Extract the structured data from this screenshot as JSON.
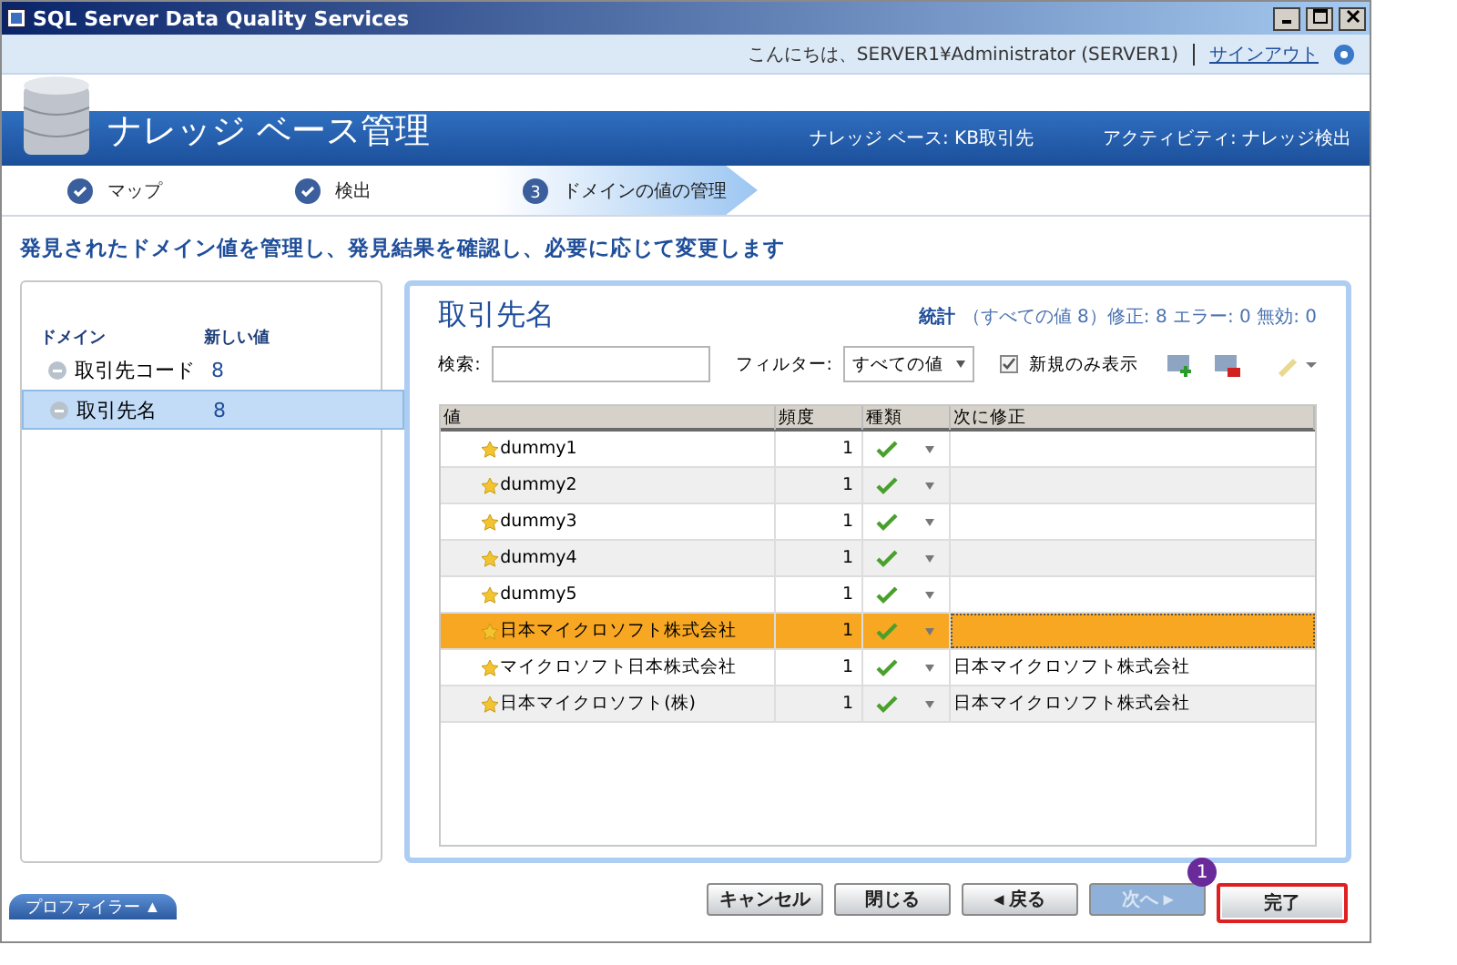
{
  "window": {
    "title": "SQL Server Data Quality Services"
  },
  "header": {
    "greeting": "こんにちは、SERVER1¥Administrator (SERVER1)",
    "signout": "サインアウト",
    "title": "ナレッジ ベース管理",
    "knowledge_base": "ナレッジ ベース: KB取引先",
    "activity": "アクティビティ: ナレッジ検出"
  },
  "steps": [
    {
      "label": "マップ",
      "kind": "done",
      "selected": false
    },
    {
      "label": "検出",
      "kind": "done",
      "selected": false
    },
    {
      "label": "ドメインの値の管理",
      "kind": "numbered",
      "number": "3",
      "selected": true
    }
  ],
  "instruction": "発見されたドメイン値を管理し、発見結果を確認し、必要に応じて変更します",
  "domains": {
    "columns": [
      "ドメイン",
      "新しい値"
    ],
    "items": [
      {
        "name": "取引先コード",
        "count": "8",
        "selected": false
      },
      {
        "name": "取引先名",
        "count": "8",
        "selected": true
      }
    ]
  },
  "detail": {
    "title": "取引先名",
    "stats_label": "統計",
    "stats": "（すべての値 8）修正: 8 エラー: 0 無効: 0",
    "search_label": "検索:",
    "filter_label": "フィルター:",
    "filter_value": "すべての値",
    "new_only": {
      "label": "新規のみ表示",
      "checked": true
    }
  },
  "table": {
    "columns": [
      "値",
      "頻度",
      "種類",
      "次に修正"
    ],
    "rows": [
      {
        "value": "dummy1",
        "frequency": "1",
        "correct_to": "",
        "selected": false
      },
      {
        "value": "dummy2",
        "frequency": "1",
        "correct_to": "",
        "selected": false
      },
      {
        "value": "dummy3",
        "frequency": "1",
        "correct_to": "",
        "selected": false
      },
      {
        "value": "dummy4",
        "frequency": "1",
        "correct_to": "",
        "selected": false
      },
      {
        "value": "dummy5",
        "frequency": "1",
        "correct_to": "",
        "selected": false
      },
      {
        "value": "日本マイクロソフト株式会社",
        "frequency": "1",
        "correct_to": "",
        "selected": true
      },
      {
        "value": "マイクロソフト日本株式会社",
        "frequency": "1",
        "correct_to": "日本マイクロソフト株式会社",
        "selected": false
      },
      {
        "value": "日本マイクロソフト(株)",
        "frequency": "1",
        "correct_to": "日本マイクロソフト株式会社",
        "selected": false
      }
    ]
  },
  "profiler_tab": "プロファイラー ▲",
  "buttons": [
    {
      "label": "キャンセル",
      "disabled": false,
      "highlighted": false
    },
    {
      "label": "閉じる",
      "disabled": false,
      "highlighted": false
    },
    {
      "label": "◂ 戻る",
      "disabled": false,
      "highlighted": false
    },
    {
      "label": "次へ ▸",
      "disabled": true,
      "highlighted": false
    },
    {
      "label": "完了",
      "disabled": false,
      "highlighted": true,
      "callout": "1"
    }
  ]
}
